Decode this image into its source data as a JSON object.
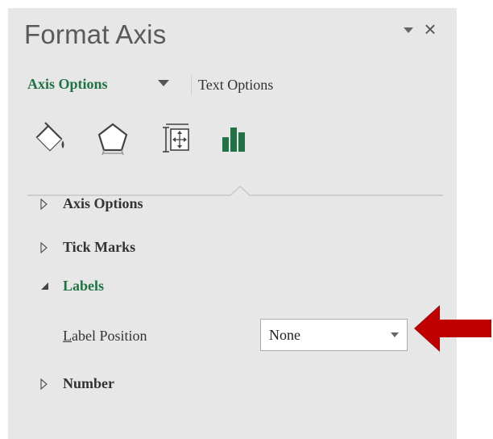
{
  "pane": {
    "title": "Format Axis",
    "menu_icon": "caret-down-icon",
    "close_icon": "close-icon",
    "close_glyph": "×"
  },
  "tabs": {
    "active_label": "Axis Options",
    "inactive_label": "Text Options"
  },
  "icons": [
    "fill-line-icon",
    "effects-pentagon-icon",
    "size-properties-icon",
    "axis-options-bar-chart-icon"
  ],
  "sections": {
    "axis_options": "Axis Options",
    "tick_marks": "Tick Marks",
    "labels": "Labels",
    "number": "Number"
  },
  "labels_section": {
    "label_position_prefix": "L",
    "label_position_rest": "abel Position",
    "label_position_value": "None"
  },
  "colors": {
    "accent_green": "#217346",
    "pane_bg": "#e7e7e7",
    "arrow_red": "#c00000"
  }
}
